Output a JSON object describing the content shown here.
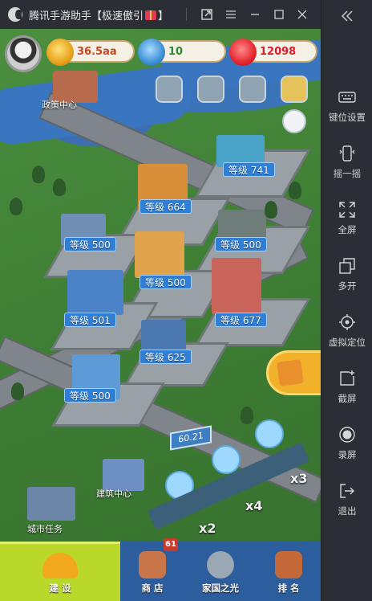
{
  "window": {
    "title_main": "腾讯手游助手【极速傲引",
    "title_end": "】",
    "buttons": [
      "external-window-icon",
      "menu-icon",
      "minimize-icon",
      "maximize-icon",
      "close-icon"
    ]
  },
  "sidebar": {
    "collapse_icon": "double-chevron-left-icon",
    "items": [
      {
        "label": "键位设置",
        "icon": "keyboard-icon"
      },
      {
        "label": "摇一摇",
        "icon": "shake-phone-icon"
      },
      {
        "label": "全屏",
        "icon": "fullscreen-icon"
      },
      {
        "label": "多开",
        "icon": "multi-window-icon"
      },
      {
        "label": "虚拟定位",
        "icon": "location-target-icon"
      },
      {
        "label": "截屏",
        "icon": "screenshot-icon"
      },
      {
        "label": "录屏",
        "icon": "record-icon"
      },
      {
        "label": "退出",
        "icon": "exit-icon"
      }
    ]
  },
  "hud": {
    "coins": "36.5aa",
    "stars": "10",
    "hearts": "12098",
    "colors": {
      "coins_text": "#c8471d",
      "stars_text": "#2b8a2b",
      "hearts_text": "#d81b2b"
    }
  },
  "map": {
    "places": [
      {
        "label": "政策中心"
      },
      {
        "label": "建筑中心"
      },
      {
        "label": "城市任务"
      }
    ],
    "buildings": [
      {
        "level": "等级 741"
      },
      {
        "level": "等级 664"
      },
      {
        "level": "等级 500"
      },
      {
        "level": "等级 500"
      },
      {
        "level": "等级 500"
      },
      {
        "level": "等级 501"
      },
      {
        "level": "等级 677"
      },
      {
        "level": "等级 625"
      },
      {
        "level": "等级 500"
      }
    ],
    "multipliers": [
      "x3",
      "x4",
      "x2"
    ],
    "sign_number": "60.21"
  },
  "nav": {
    "tabs": [
      {
        "label": "建 设",
        "active": true
      },
      {
        "label": "商 店",
        "badge": "61"
      },
      {
        "label": "家国之光"
      },
      {
        "label": "排 名"
      }
    ]
  }
}
